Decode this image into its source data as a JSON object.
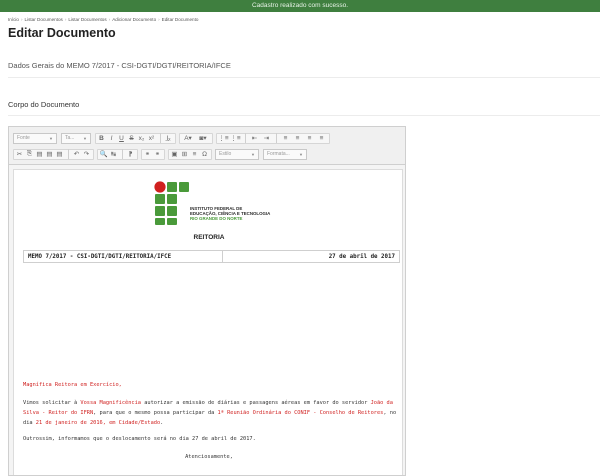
{
  "flash": {
    "message": "Cadastro realizado com sucesso."
  },
  "breadcrumb": [
    "Início",
    "Listar Documentos",
    "Listar Documentos",
    "Adicionar Documento",
    "Editar Documento"
  ],
  "page": {
    "title": "Editar Documento"
  },
  "sections": {
    "general": "Dados Gerais do MEMO 7/2017 - CSI-DGTI/DGTI/REITORIA/IFCE",
    "body": "Corpo do Documento"
  },
  "toolbar": {
    "font_combo": "Fonte",
    "size_combo": "Ta...",
    "style_combo": "Estilo",
    "format_combo": "Formata...",
    "row1_buttons": [
      "B",
      "I",
      "U",
      "S",
      "x₂",
      "x²",
      "I̲ₓ",
      "A▾",
      "◙▾",
      "⋮≡",
      "⋮≡",
      "⇤",
      "⇥",
      "≡",
      "≡",
      "≡",
      "≡"
    ],
    "row2_buttons": [
      "✂",
      "⎘",
      "▤",
      "▤",
      "▤",
      "↶",
      "↷",
      "🔍",
      "↹",
      "⁋",
      "⚭",
      "⚭",
      "▣",
      "⊞",
      "≡",
      "Ω"
    ]
  },
  "document": {
    "logo_text": [
      "INSTITUTO FEDERAL DE",
      "EDUCAÇÃO, CIÊNCIA E TECNOLOGIA"
    ],
    "logo_subtext": "RIO GRANDE DO NORTE",
    "header": "REITORIA",
    "memo_id": "MEMO 7/2017 - CSI-DGTI/DGTI/REITORIA/IFCE",
    "memo_date": "27 de abril de 2017",
    "salutation": "Magnífica Reitora em Exercício,",
    "p1_a": "Vimos solicitar à ",
    "p1_b": "Vossa Magnificência",
    "p1_c": " autorizar a emissão de diárias e passagens aéreas em favor do servidor ",
    "p1_d": "João da Silva - Reitor do IFRN",
    "p1_e": ", para que o mesmo possa participar da ",
    "p1_f": "1ª Reunião Ordinária do CONIF - Conselho de Reitores",
    "p1_g": ", no dia ",
    "p1_h": "21 de janeiro de 2016, em Cidade/Estado",
    "p1_i": ".",
    "p2": "Outrossim, informamos que o deslocamento será no dia 27 de abril de 2017.",
    "closing": "Atenciosamente,"
  },
  "colors": {
    "flash_bg": "#3f7f3f",
    "logo_green": "#4a9a3a",
    "logo_red": "#d0201f",
    "highlight_red": "#d0201f"
  }
}
